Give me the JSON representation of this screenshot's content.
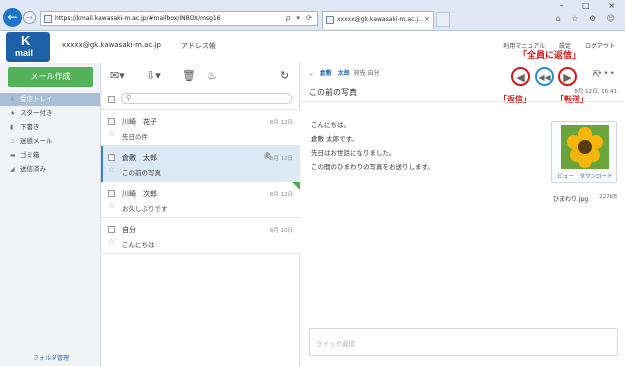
{
  "browser": {
    "url": "https://kmail.kawasaki-m.ac.jp/#mailbox/INBOX/msg16",
    "address_tools": "ρ ▾ ⟳",
    "tab_title": "xxxxx@gk.kawasaki-m.ac.j...",
    "tab_close": "×",
    "window_controls": "– □ ×",
    "back_icon": "←",
    "forward_icon": "→",
    "tools_icons": "⌂ ☆ ⚙ ☺"
  },
  "header": {
    "logo_k": "K",
    "logo_mail": "mail",
    "account": "xxxxx@gk.kawasaki-m.ac.jp",
    "address_book": "アドレス帳",
    "links": [
      "利用マニュアル",
      "設定",
      "ログアウト"
    ],
    "annotation_reply_all": "「全員に返信」"
  },
  "sidebar": {
    "compose_label": "メール作成",
    "items": [
      {
        "icon": "⇩",
        "label": "受信トレイ"
      },
      {
        "icon": "★",
        "label": "スター付き"
      },
      {
        "icon": "▮",
        "label": "下書き"
      },
      {
        "icon": "♨",
        "label": "迷惑メール"
      },
      {
        "icon": "▬",
        "label": "ゴミ箱"
      },
      {
        "icon": "◢",
        "label": "送信済み"
      }
    ],
    "folder_admin": "フォルダ管理"
  },
  "list": {
    "toolbar_icons": [
      "✉▾",
      "⇩▾",
      "🗑",
      "♨",
      "↻"
    ],
    "search_icon": "⚲",
    "messages": [
      {
        "sender": "川崎　花子",
        "subject": "先日の件",
        "date": "8月 12日",
        "star": "☆"
      },
      {
        "sender": "倉敷　太郎",
        "subject": "この前の写真",
        "date": "8月 12日",
        "star": "☆",
        "clip": "🖇"
      },
      {
        "sender": "川崎　次郎",
        "subject": "お久しぶりです",
        "date": "8月 12日",
        "star": "☆"
      },
      {
        "sender": "自分",
        "subject": "こんにちは",
        "date": "8月 10日",
        "star": "☆"
      }
    ]
  },
  "reader": {
    "collapse": "⌄",
    "from_name": "倉敷　太郎",
    "to_label": "宛先 自分",
    "subject": "この前の写真",
    "date": "8月 12日, 16:41",
    "reply_icon": "◀",
    "reply_all_icon": "◀◀",
    "forward_icon": "▶",
    "popout_icon": "⇱",
    "more_icon": "•••",
    "annotation_reply": "「返信」",
    "annotation_forward": "「転送」",
    "body": [
      "こんにちは。",
      "倉敷 太郎です。",
      "先日はお世話になりました。",
      "この間のひまわりの写真をお送りします。"
    ],
    "attachment": {
      "actions": "ビュー　ダウンロード",
      "name": "ひまわり.jpg",
      "size": "227KB"
    },
    "quick_reply_placeholder": "クイック返信"
  }
}
